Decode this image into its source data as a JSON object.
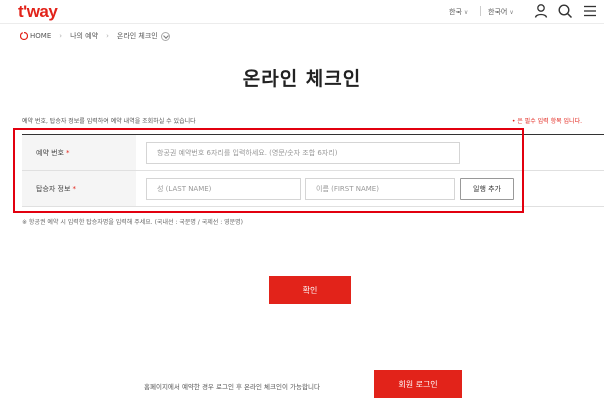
{
  "header": {
    "logo_text": "t'way",
    "country_label": "한국",
    "language_label": "한국어",
    "user_icon": "user-icon",
    "search_icon": "search-icon",
    "menu_icon": "hamburger-menu-icon",
    "brand_color": "#e2231a"
  },
  "breadcrumb": {
    "items": [
      "HOME",
      "나의 예약",
      "온라인 체크인"
    ]
  },
  "page": {
    "title": "온라인 체크인",
    "description": "예약 번호, 탑승자 정보를 입력하여 예약 내역을 조회하실 수 있습니다",
    "required_note": "• 은 필수 입력 항목 입니다."
  },
  "form": {
    "booking_label": "예약 번호",
    "booking_placeholder": "항공권 예약번호 6자리를 입력하세요. (영문/숫자 조합 6자리)",
    "passenger_label": "탑승자 정보",
    "last_name_placeholder": "성 (LAST NAME)",
    "first_name_placeholder": "이름 (FIRST NAME)",
    "add_companion_label": "일행 추가",
    "required_mark": "*"
  },
  "footnote": "※ 항공권 예약 시 입력한 탑승자명을 입력해 주세요. (국내선 : 국문명 / 국제선 : 영문명)",
  "actions": {
    "confirm_label": "확인",
    "member_text": "홈페이지에서 예약한 경우 로그인 후 온라인 체크인이 가능합니다",
    "member_login_label": "회원 로그인"
  }
}
